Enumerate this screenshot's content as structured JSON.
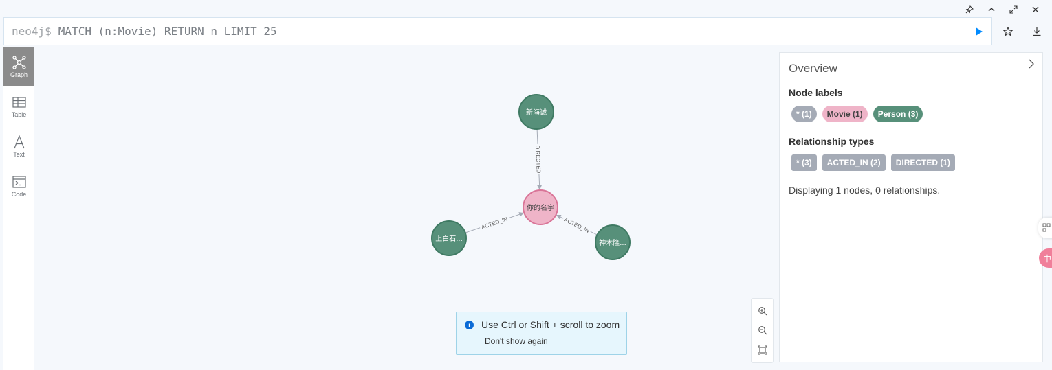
{
  "editor": {
    "prompt": "neo4j$",
    "query": "MATCH (n:Movie) RETURN n LIMIT 25"
  },
  "window_controls": [
    "pin-icon",
    "chevron-up-icon",
    "expand-icon",
    "close-icon"
  ],
  "editor_actions": [
    "run-icon",
    "star-icon",
    "download-icon"
  ],
  "sidebar": {
    "items": [
      {
        "label": "Graph",
        "icon": "graph-icon",
        "active": true
      },
      {
        "label": "Table",
        "icon": "table-icon",
        "active": false
      },
      {
        "label": "Text",
        "icon": "text-icon",
        "active": false
      },
      {
        "label": "Code",
        "icon": "code-icon",
        "active": false
      }
    ]
  },
  "graph": {
    "nodes": [
      {
        "label": "新海诚",
        "type": "Person"
      },
      {
        "label": "你的名字",
        "type": "Movie"
      },
      {
        "label": "上白石...",
        "type": "Person"
      },
      {
        "label": "神木隆...",
        "type": "Person"
      }
    ],
    "relationships": [
      {
        "label": "DIRECTED"
      },
      {
        "label": "ACTED_IN"
      },
      {
        "label": "ACTED_IN"
      }
    ],
    "colors": {
      "person_fill": "#57907a",
      "person_stroke": "#3f7a63",
      "movie_fill": "#efb4c8",
      "movie_stroke": "#d97497",
      "edge": "#a5abb6"
    }
  },
  "zoom_tip": {
    "message": "Use Ctrl or Shift + scroll to zoom",
    "dismiss": "Don't show again"
  },
  "overview": {
    "title": "Overview",
    "node_labels_heading": "Node labels",
    "node_labels": [
      {
        "text": "* (1)",
        "bg": "#a5abb6",
        "fg": "#ffffff"
      },
      {
        "text": "Movie (1)",
        "bg": "#efb4c8",
        "fg": "#444444"
      },
      {
        "text": "Person (3)",
        "bg": "#57907a",
        "fg": "#ffffff"
      }
    ],
    "rel_types_heading": "Relationship types",
    "rel_types": [
      {
        "text": "* (3)"
      },
      {
        "text": "ACTED_IN (2)"
      },
      {
        "text": "DIRECTED (1)"
      }
    ],
    "status": "Displaying 1 nodes, 0 relationships."
  },
  "edge_tab2_text": "中"
}
